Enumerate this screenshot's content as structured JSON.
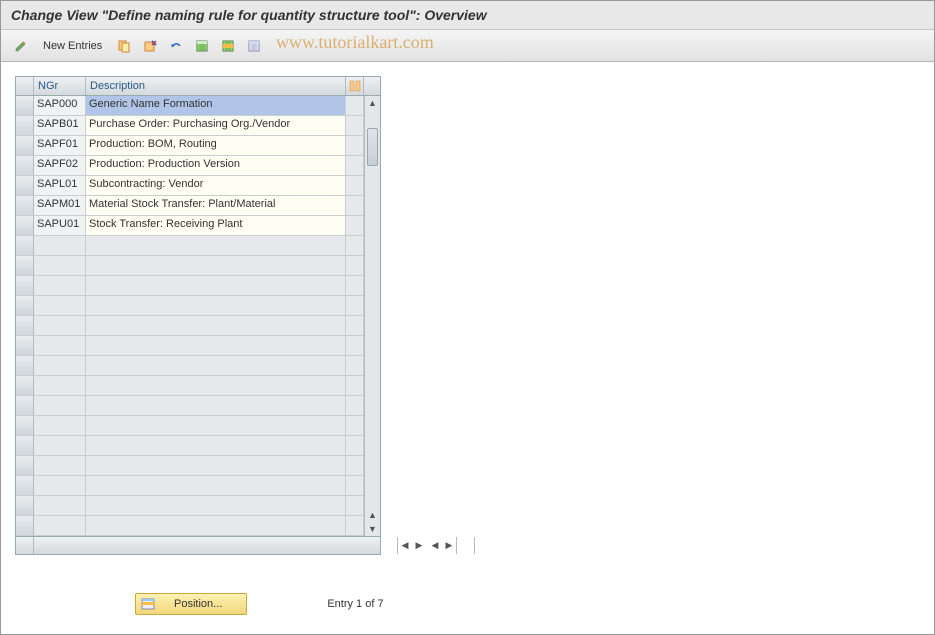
{
  "title": "Change View \"Define naming rule for quantity structure tool\": Overview",
  "toolbar": {
    "new_entries_label": "New Entries"
  },
  "watermark": "www.tutorialkart.com",
  "columns": {
    "ngr": "NGr",
    "description": "Description"
  },
  "rows": [
    {
      "ngr": "SAP000",
      "description": "Generic Name Formation",
      "selected": true
    },
    {
      "ngr": "SAPB01",
      "description": "Purchase Order: Purchasing Org./Vendor"
    },
    {
      "ngr": "SAPF01",
      "description": "Production: BOM, Routing"
    },
    {
      "ngr": "SAPF02",
      "description": "Production: Production Version"
    },
    {
      "ngr": "SAPL01",
      "description": "Subcontracting: Vendor"
    },
    {
      "ngr": "SAPM01",
      "description": "Material Stock Transfer: Plant/Material"
    },
    {
      "ngr": "SAPU01",
      "description": "Stock Transfer: Receiving Plant"
    }
  ],
  "empty_rows": 15,
  "footer": {
    "position_label": "Position...",
    "entry_text": "Entry 1 of 7"
  },
  "colors": {
    "accent_blue": "#2a5a88",
    "edit_yellow": "#fefff2",
    "pos_button": "#f2d77a"
  }
}
